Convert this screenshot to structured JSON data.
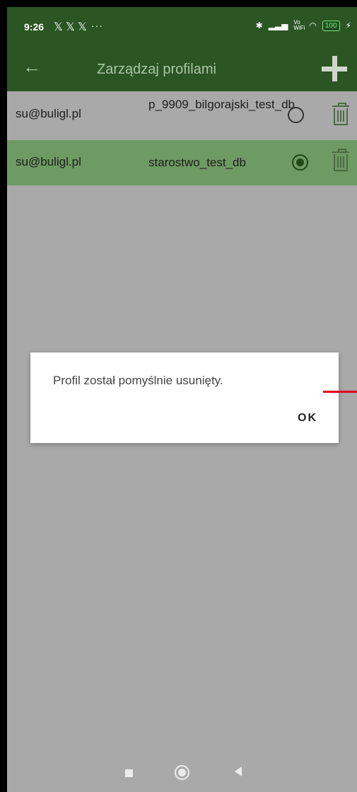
{
  "statusbar": {
    "time": "9:26",
    "x_icons": [
      "𝕏",
      "𝕏",
      "𝕏"
    ],
    "more": "···",
    "signal_text": "ⁱᵢ",
    "wifi_label": "Vo WiFi",
    "battery": "100"
  },
  "appbar": {
    "title": "Zarządzaj profilami"
  },
  "profiles": [
    {
      "email": "su@buligl.pl",
      "database": "p_9909_bilgorajski_test_db",
      "selected": false
    },
    {
      "email": "su@buligl.pl",
      "database": "starostwo_test_db",
      "selected": true
    }
  ],
  "dialog": {
    "message": "Profil został pomyślnie usunięty.",
    "ok_label": "OK"
  },
  "colors": {
    "appbar": "#2b5623",
    "selected_row": "#6e9a63",
    "overlay_background": "#a9a9a9",
    "annotation": "#e0001b"
  }
}
